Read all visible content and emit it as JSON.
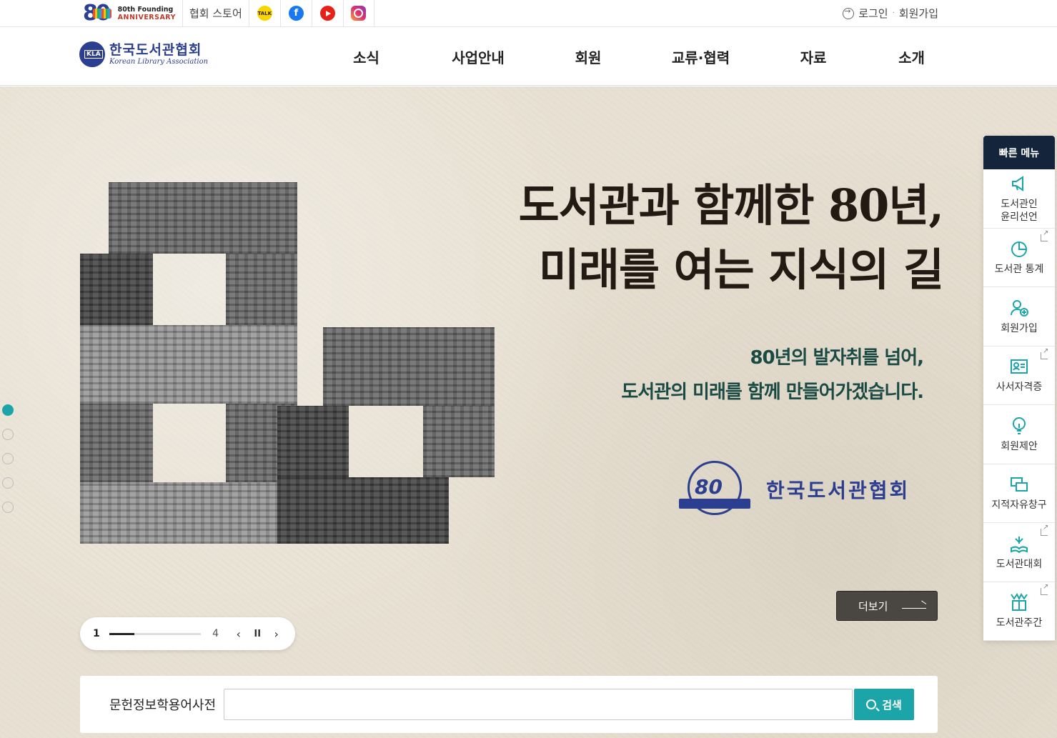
{
  "topbar": {
    "anniversary_line1": "80th Founding",
    "anniversary_line2": "ANNIVERSARY",
    "anniversary_number": "80",
    "store_label": "협회 스토어",
    "kakao_label": "TALK",
    "login_label": "로그인",
    "separator": "·",
    "join_label": "회원가입"
  },
  "header": {
    "logo_ko": "한국도서관협회",
    "logo_en": "Korean Library Association",
    "nav": [
      "소식",
      "사업안내",
      "회원",
      "교류·협력",
      "자료",
      "소개"
    ]
  },
  "hero": {
    "title_line1": "도서관과 함께한 80년,",
    "title_line2": "미래를 여는 지식의 길",
    "subtitle_line1": "80년의 발자취를 넘어,",
    "subtitle_line2": "도서관의 미래를 함께 만들어가겠습니다.",
    "seal_number": "80",
    "seal_name": "한국도서관협회",
    "more_label": "더보기"
  },
  "pager": {
    "current": "1",
    "total": "4",
    "progress": 0.25,
    "prev": "‹",
    "pause": "II",
    "next": "›"
  },
  "search": {
    "label": "문헌정보학용어사전",
    "placeholder": "",
    "button_label": "검색"
  },
  "quick_menu": {
    "title": "빠른 메뉴",
    "items": [
      {
        "label": "도서관인\n윤리선언",
        "icon": "megaphone-icon",
        "external": false
      },
      {
        "label": "도서관 통계",
        "icon": "pie-chart-icon",
        "external": true
      },
      {
        "label": "회원가입",
        "icon": "user-plus-icon",
        "external": false
      },
      {
        "label": "사서자격증",
        "icon": "id-card-icon",
        "external": true
      },
      {
        "label": "회원제안",
        "icon": "lightbulb-icon",
        "external": false
      },
      {
        "label": "지적자유창구",
        "icon": "chat-bubbles-icon",
        "external": false
      },
      {
        "label": "도서관대회",
        "icon": "book-spark-icon",
        "external": true
      },
      {
        "label": "도서관주간",
        "icon": "book-flag-icon",
        "external": true
      }
    ]
  },
  "colors": {
    "brand_navy": "#2c3e8f",
    "accent_teal": "#1ba5a8",
    "hero_bg": "#e8e1d3",
    "quick_head": "#14253b"
  }
}
